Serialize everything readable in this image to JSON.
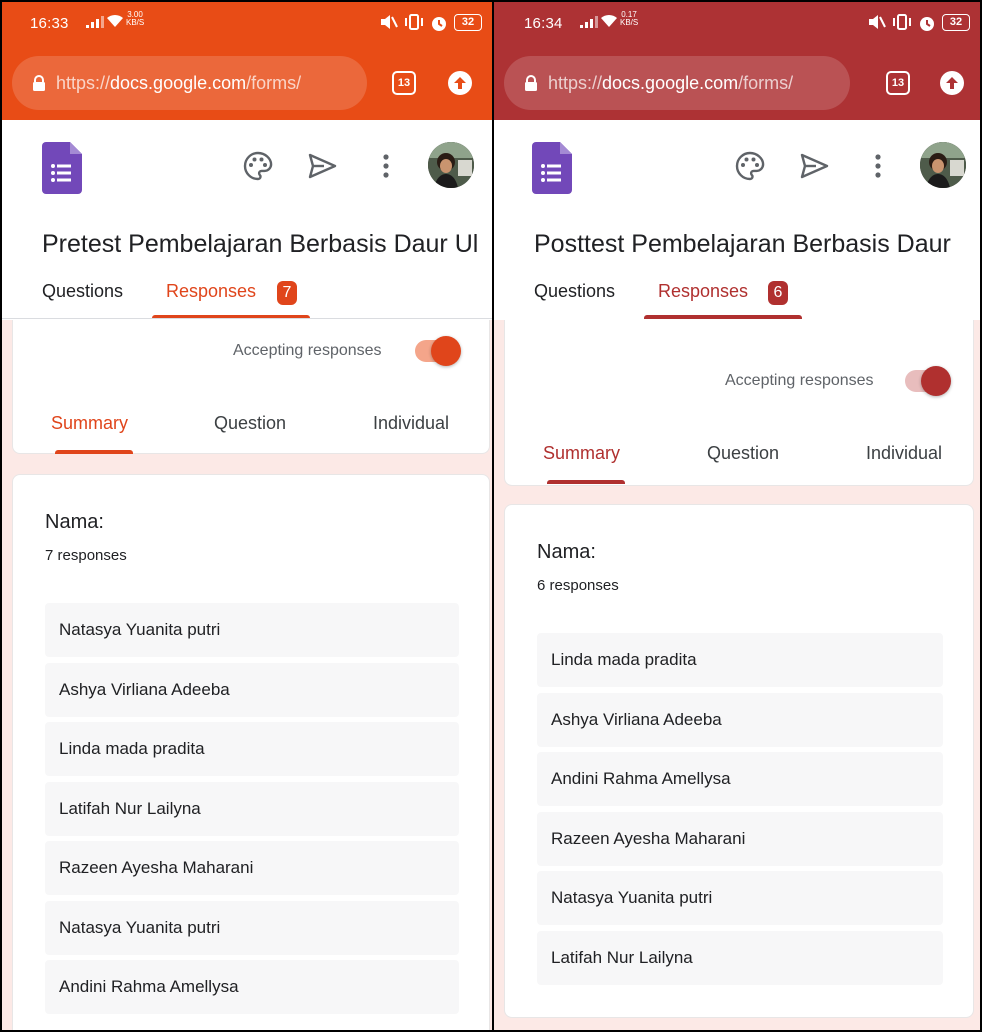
{
  "left": {
    "accent": "#e0451b",
    "topbar": "#e84c16",
    "status": {
      "time": "16:33",
      "net_speed_top": "3.00",
      "net_speed_unit": "KB/S",
      "battery": "32"
    },
    "browser": {
      "url_scheme": "https://",
      "url_host": "docs.google.com",
      "url_path": "/forms/",
      "tab_count": "13"
    },
    "form_title": "Pretest Pembelajaran Berbasis Daur Ul",
    "tabs": {
      "questions": "Questions",
      "responses": "Responses",
      "responses_count": "7"
    },
    "accepting_label": "Accepting responses",
    "subtabs": {
      "summary": "Summary",
      "question": "Question",
      "individual": "Individual"
    },
    "question": {
      "title": "Nama:",
      "count_text": "7 responses",
      "responses": [
        "Natasya Yuanita putri",
        "Ashya Virliana Adeeba",
        "Linda mada pradita",
        "Latifah Nur Lailyna",
        "Razeen Ayesha Maharani",
        "Natasya Yuanita putri",
        "Andini Rahma Amellysa"
      ]
    }
  },
  "right": {
    "accent": "#b0302f",
    "topbar": "#ad3234",
    "status": {
      "time": "16:34",
      "net_speed_top": "0.17",
      "net_speed_unit": "KB/S",
      "battery": "32"
    },
    "browser": {
      "url_scheme": "https://",
      "url_host": "docs.google.com",
      "url_path": "/forms/",
      "tab_count": "13"
    },
    "form_title": "Posttest Pembelajaran Berbasis Daur L",
    "tabs": {
      "questions": "Questions",
      "responses": "Responses",
      "responses_count": "6"
    },
    "accepting_label": "Accepting responses",
    "subtabs": {
      "summary": "Summary",
      "question": "Question",
      "individual": "Individual"
    },
    "question": {
      "title": "Nama:",
      "count_text": "6 responses",
      "responses": [
        "Linda mada pradita",
        "Ashya Virliana Adeeba",
        "Andini Rahma Amellysa",
        "Razeen Ayesha Maharani",
        "Natasya Yuanita putri",
        "Latifah Nur Lailyna"
      ]
    }
  }
}
